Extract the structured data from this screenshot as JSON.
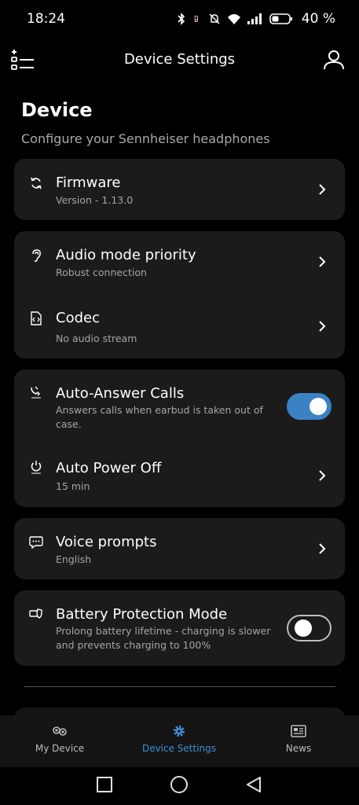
{
  "status_bar": {
    "time": "18:24",
    "battery_percent": "40 %",
    "icons": [
      "bluetooth-icon",
      "battery-small-icon",
      "mute-icon",
      "wifi-icon",
      "signal-icon",
      "battery-icon"
    ]
  },
  "app_bar": {
    "title": "Device Settings",
    "menu_icon": "settings-list-icon",
    "account_icon": "user-icon"
  },
  "page": {
    "heading": "Device",
    "subheading": "Configure your Sennheiser headphones"
  },
  "settings": {
    "firmware": {
      "title": "Firmware",
      "subtitle": "Version - 1.13.0",
      "icon": "refresh-icon"
    },
    "audio_mode": {
      "title": "Audio mode priority",
      "subtitle": "Robust connection",
      "icon": "ear-icon"
    },
    "codec": {
      "title": "Codec",
      "subtitle": "No audio stream",
      "icon": "code-file-icon"
    },
    "auto_answer": {
      "title": "Auto-Answer Calls",
      "subtitle": "Answers calls when earbud is taken out of case.",
      "icon": "auto-answer-icon",
      "enabled": true
    },
    "auto_power_off": {
      "title": "Auto Power Off",
      "subtitle": "15 min",
      "icon": "auto-power-icon"
    },
    "voice_prompts": {
      "title": "Voice prompts",
      "subtitle": "English",
      "icon": "speech-bubble-icon"
    },
    "battery_protection": {
      "title": "Battery Protection Mode",
      "subtitle": "Prolong battery lifetime - charging is slower and prevents charging to 100%",
      "icon": "battery-shield-icon",
      "enabled": false
    }
  },
  "bottom_nav": {
    "items": [
      {
        "label": "My Device",
        "icon": "earbuds-icon",
        "active": false
      },
      {
        "label": "Device Settings",
        "icon": "gear-icon",
        "active": true
      },
      {
        "label": "News",
        "icon": "news-icon",
        "active": false
      }
    ]
  },
  "colors": {
    "accent": "#3b82c4",
    "card_background": "#1b1b1b",
    "background": "#000000"
  }
}
